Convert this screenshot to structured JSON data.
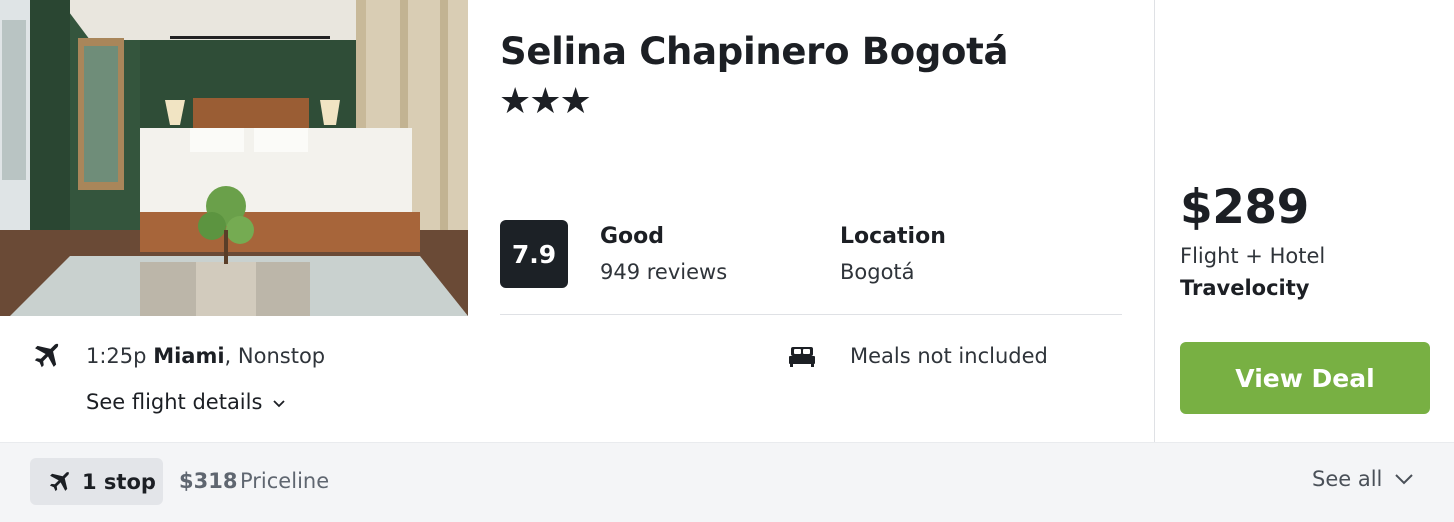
{
  "hotel": {
    "name": "Selina Chapinero Bogotá",
    "stars": "★★★",
    "score": "7.9",
    "rating_word": "Good",
    "reviews": "949 reviews",
    "location_label": "Location",
    "location_value": "Bogotá",
    "photo_icon": "hotel-room-photo"
  },
  "flight": {
    "time": "1:25p",
    "city": "Miami",
    "stops": ", Nonstop",
    "details_label": "See flight details",
    "icon": "plane-icon"
  },
  "meals": {
    "label": "Meals not included",
    "icon": "bed-icon"
  },
  "deal": {
    "price": "$289",
    "package": "Flight + Hotel",
    "provider": "Travelocity",
    "button_label": "View Deal"
  },
  "footer": {
    "stop_chip_label": "1 stop",
    "alt_price": "$318",
    "alt_provider": "Priceline",
    "see_all_label": "See all"
  },
  "colors": {
    "accent_green": "#78b043",
    "badge_dark": "#1c2126",
    "text_primary": "#1c1f24",
    "footer_bg": "#f4f5f7"
  }
}
